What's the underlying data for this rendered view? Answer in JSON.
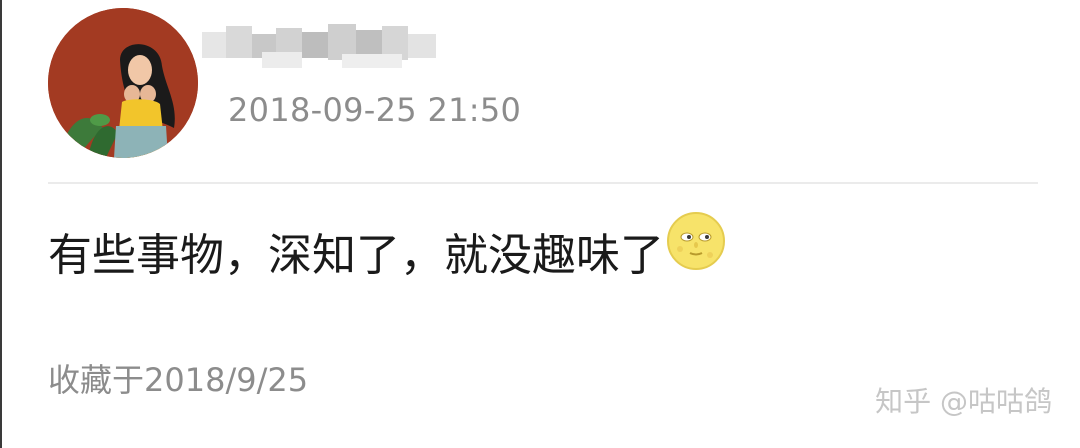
{
  "post": {
    "username": "",
    "timestamp": "2018-09-25 21:50",
    "content": "有些事物，深知了，就没趣味了",
    "content_emoji": "full-moon-with-face-icon",
    "collected_label": "收藏于2018/9/25"
  },
  "watermark": {
    "text": "知乎 @咕咕鸽"
  },
  "colors": {
    "avatar_bg": "#a33a22",
    "meta_text": "#8c8c8c",
    "body_text": "#1a1a1a",
    "divider": "#ebebeb",
    "watermark": "#c6c6c6"
  }
}
